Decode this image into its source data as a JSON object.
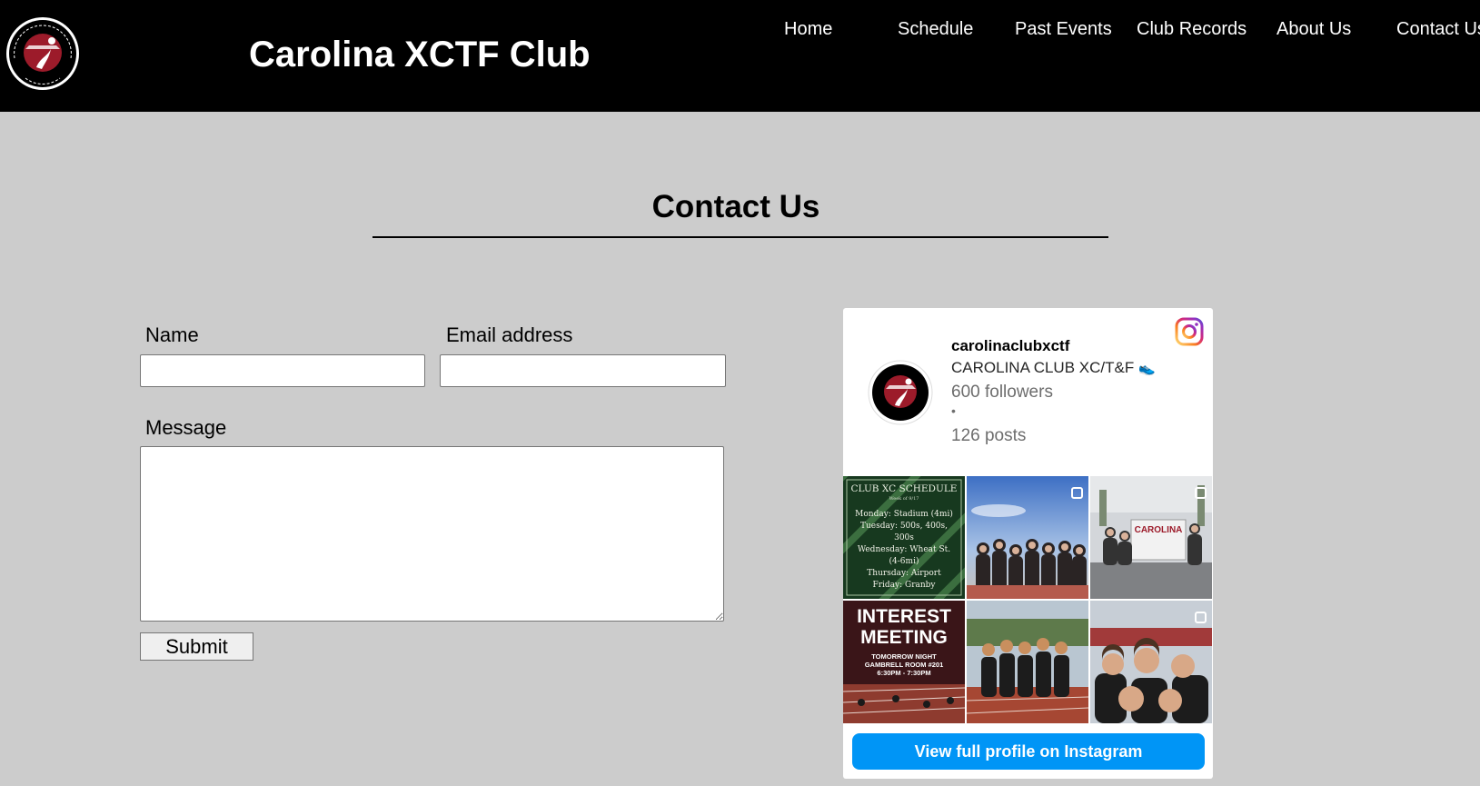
{
  "header": {
    "logo_text": "SOUTH CAROLINA GAMECOCKS CLUB XC/TF",
    "site_title": "Carolina XCTF Club",
    "nav": [
      "Home",
      "Schedule",
      "Past Events",
      "Club Records",
      "About Us",
      "Contact Us"
    ]
  },
  "main": {
    "title": "Contact Us",
    "form": {
      "name_label": "Name",
      "name_value": "",
      "email_label": "Email address",
      "email_value": "",
      "message_label": "Message",
      "message_value": "",
      "submit_label": "Submit"
    }
  },
  "instagram": {
    "username": "carolinaclubxctf",
    "display_name": "CAROLINA CLUB XC/T&F",
    "display_emoji": "👟",
    "followers": "600 followers",
    "separator": "•",
    "posts": "126 posts",
    "button_label": "View full profile on Instagram",
    "posts_grid": [
      {
        "kind": "schedule",
        "title": "CLUB XC SCHEDULE",
        "subtitle": "Week of 9/17",
        "lines": [
          "Monday: Stadium (4mi)",
          "Tuesday: 500s, 400s,",
          "300s",
          "Wednesday: Wheat St.",
          "(4-6mi)",
          "Thursday: Airport",
          "Friday: Granby"
        ]
      },
      {
        "kind": "photo",
        "multi": true
      },
      {
        "kind": "photo",
        "multi": true,
        "sign": "CAROLINA"
      },
      {
        "kind": "flyer",
        "headline1": "INTEREST",
        "headline2": "MEETING",
        "line1": "TOMORROW NIGHT",
        "line2": "GAMBRELL ROOM #201",
        "line3": "6:30PM - 7:30PM"
      },
      {
        "kind": "photo",
        "multi": false
      },
      {
        "kind": "photo",
        "multi": true
      }
    ]
  },
  "colors": {
    "header_bg": "#000000",
    "page_bg": "#cccccc",
    "brand_garnet": "#73000a",
    "ig_button": "#0095f6"
  }
}
